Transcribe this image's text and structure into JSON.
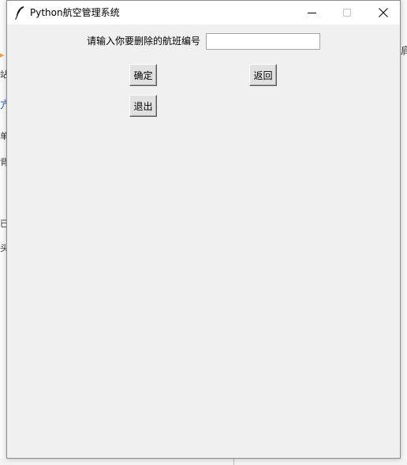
{
  "window": {
    "title": "Python航空管理系统",
    "icon": "feather-icon"
  },
  "titlebar_buttons": {
    "minimize": "minimize-icon",
    "maximize": "maximize-icon",
    "close": "close-icon"
  },
  "form": {
    "prompt_label": "请输入你要删除的航班编号",
    "flight_input_value": "",
    "confirm_label": "确定",
    "back_label": "返回",
    "exit_label": "退出"
  },
  "background_fragments": [
    "站",
    "亢",
    "单",
    "背",
    "已",
    "头",
    "肩"
  ],
  "colors": {
    "window_bg": "#f0f0f0",
    "titlebar_bg": "#ffffff",
    "button_face": "#e1e1e1",
    "desktop_accent": "#2b579a"
  }
}
